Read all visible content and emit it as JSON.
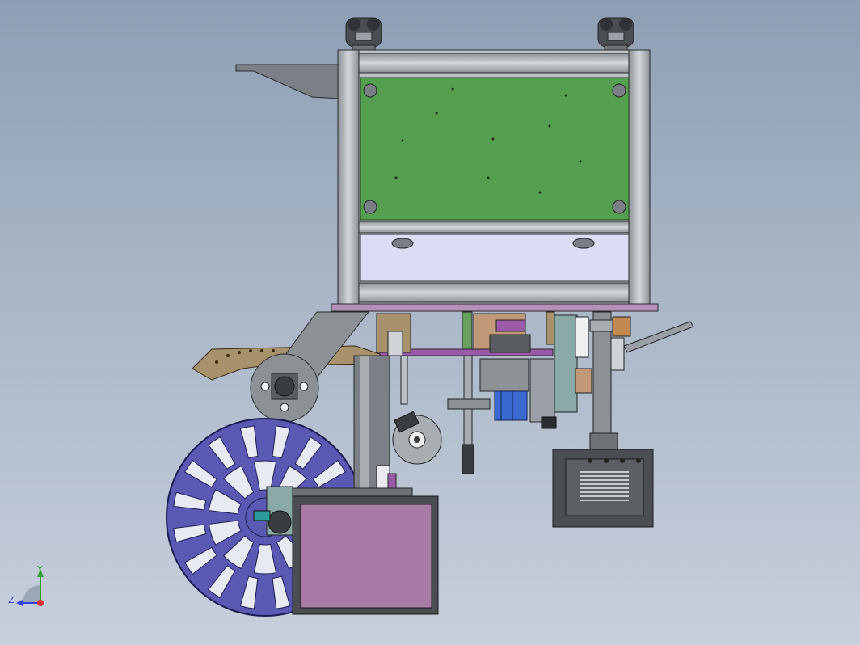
{
  "viewport": {
    "background_top": "#8e9fb5",
    "background_bottom": "#c7d0dc"
  },
  "model": {
    "frame_color": "#a8adb2",
    "panel_color": "#55a050",
    "screen_color": "#dcdcf5",
    "reel_color": "#5a5ab4",
    "display_color": "#a87aa6",
    "accent_purple": "#9a5aa8",
    "bracket_brown": "#a8926c",
    "icons": [
      "reel-icon",
      "monitor-icon",
      "caster-icon"
    ]
  },
  "triad": {
    "x_axis_color": "#d83030",
    "y_axis_color": "#30a030",
    "z_axis_color": "#3040d8",
    "y_label": "Y",
    "z_label": "Z"
  }
}
